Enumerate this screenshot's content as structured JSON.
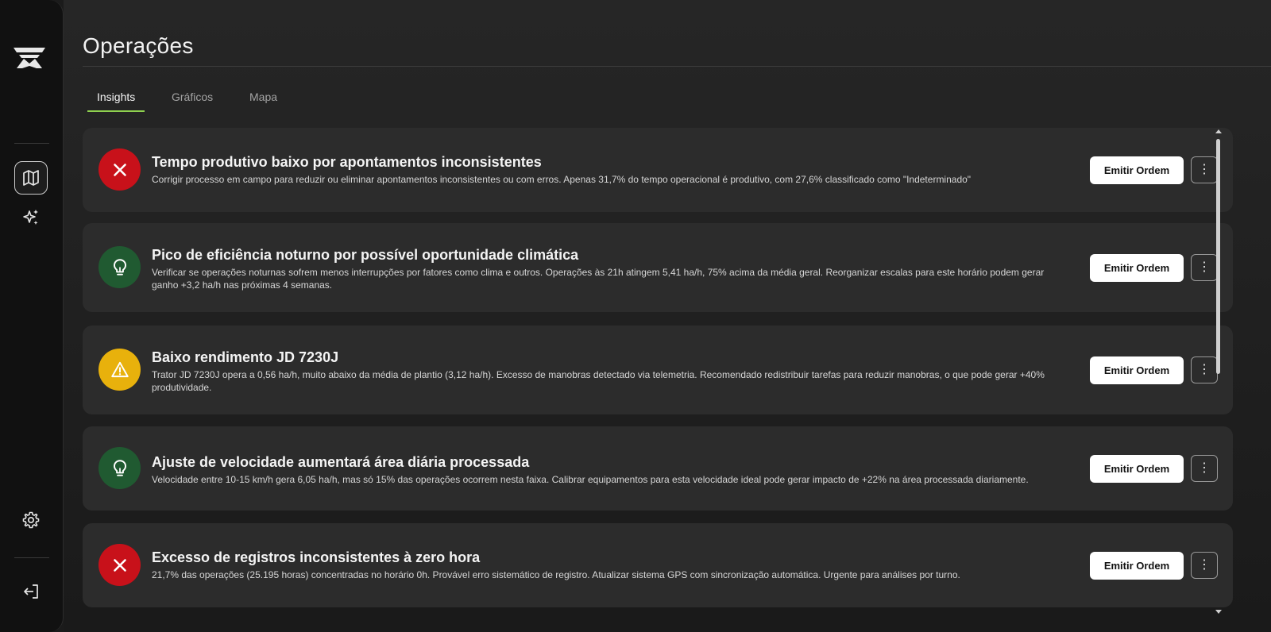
{
  "sidebar": {
    "logo_icon": "brand-logo-icon",
    "items": [
      {
        "name": "map",
        "icon": "map-icon",
        "active": true
      },
      {
        "name": "insights",
        "icon": "sparkles-icon",
        "active": false
      }
    ],
    "settings_icon": "gear-icon",
    "logout_icon": "logout-icon"
  },
  "page": {
    "title": "Operações"
  },
  "tabs": [
    {
      "label": "Insights",
      "active": true
    },
    {
      "label": "Gráficos",
      "active": false
    },
    {
      "label": "Mapa",
      "active": false
    }
  ],
  "colors": {
    "accent": "#8fd14f",
    "status_red": "#c8111a",
    "status_green": "#205a31",
    "status_yellow": "#e8b10c"
  },
  "insights": [
    {
      "status": "error",
      "icon": "close-icon",
      "title": "Tempo produtivo baixo por apontamentos inconsistentes",
      "description": "Corrigir processo em campo para reduzir ou eliminar apontamentos inconsistentes ou com erros. Apenas 31,7% do tempo operacional é produtivo, com 27,6% classificado como \"Indeterminado\"",
      "button": "Emitir Ordem"
    },
    {
      "status": "opportunity",
      "icon": "lightbulb-icon",
      "title": "Pico de eficiência noturno por possível oportunidade climática",
      "description": "Verificar se operações noturnas sofrem menos interrupções por fatores como clima e outros. Operações às 21h atingem 5,41 ha/h, 75% acima da média geral. Reorganizar escalas para este horário podem gerar ganho +3,2 ha/h nas próximas 4 semanas.",
      "button": "Emitir Ordem"
    },
    {
      "status": "warning",
      "icon": "warning-icon",
      "title": "Baixo rendimento JD 7230J",
      "description": "Trator JD 7230J opera a 0,56 ha/h, muito abaixo da média de plantio (3,12 ha/h). Excesso de manobras detectado via telemetria. Recomendado redistribuir tarefas para reduzir manobras, o que pode gerar +40% produtividade.",
      "button": "Emitir Ordem"
    },
    {
      "status": "opportunity",
      "icon": "lightbulb-icon",
      "title": "Ajuste de velocidade aumentará área diária processada",
      "description": "Velocidade entre 10-15 km/h gera 6,05 ha/h, mas só 15% das operações ocorrem nesta faixa. Calibrar equipamentos para esta velocidade ideal pode gerar impacto de +22% na área processada diariamente.",
      "button": "Emitir Ordem"
    },
    {
      "status": "error",
      "icon": "close-icon",
      "title": "Excesso de registros inconsistentes à zero hora",
      "description": "21,7% das operações (25.195 horas) concentradas no horário 0h. Provável erro sistemático de registro. Atualizar sistema GPS com sincronização automática. Urgente para análises por turno.",
      "button": "Emitir Ordem"
    }
  ],
  "more_icon": "more-vertical-icon"
}
